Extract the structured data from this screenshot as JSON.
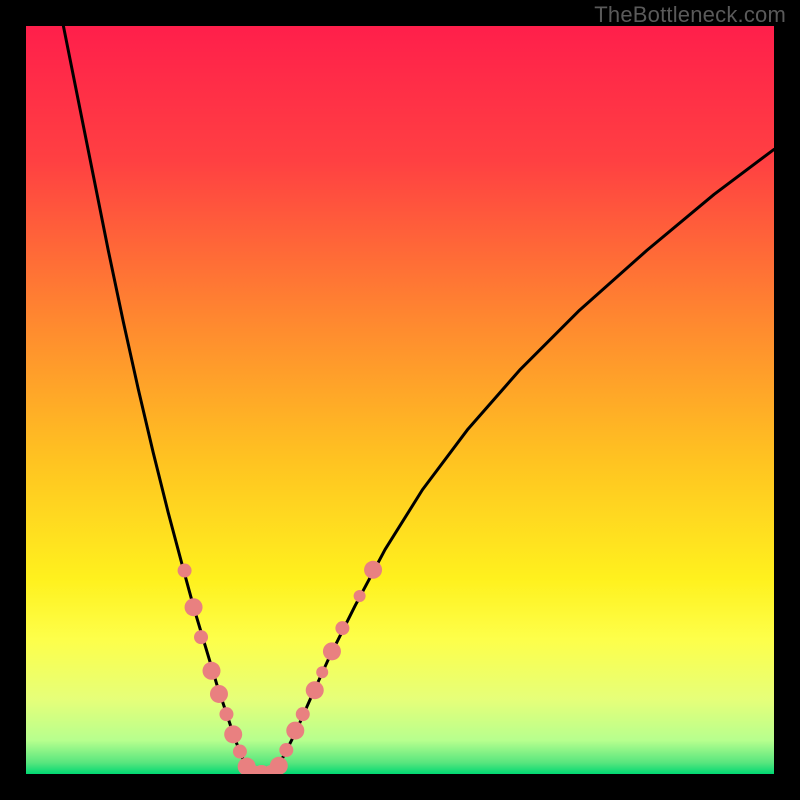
{
  "watermark": "TheBottleneck.com",
  "chart_data": {
    "type": "line",
    "title": "",
    "xlabel": "",
    "ylabel": "",
    "xlim": [
      0,
      100
    ],
    "ylim": [
      0,
      100
    ],
    "grid": false,
    "legend": null,
    "gradient_stops": [
      {
        "offset": 0.0,
        "color": "#ff1f4b"
      },
      {
        "offset": 0.18,
        "color": "#ff4042"
      },
      {
        "offset": 0.4,
        "color": "#ff8a2f"
      },
      {
        "offset": 0.58,
        "color": "#ffc321"
      },
      {
        "offset": 0.74,
        "color": "#fff11e"
      },
      {
        "offset": 0.82,
        "color": "#fdff4a"
      },
      {
        "offset": 0.9,
        "color": "#e6ff79"
      },
      {
        "offset": 0.955,
        "color": "#b7ff8e"
      },
      {
        "offset": 0.985,
        "color": "#58e67e"
      },
      {
        "offset": 1.0,
        "color": "#00d873"
      }
    ],
    "series": [
      {
        "name": "left-branch",
        "stroke": "#000000",
        "x": [
          5,
          7,
          9,
          11,
          13,
          15,
          17,
          19,
          21,
          22.5,
          24,
          25.5,
          27,
          28,
          29,
          30
        ],
        "y": [
          100,
          90,
          80,
          70,
          60.5,
          51.5,
          43,
          35,
          27.5,
          22,
          17,
          12,
          7.5,
          4.5,
          2,
          0
        ]
      },
      {
        "name": "right-branch",
        "stroke": "#000000",
        "x": [
          33,
          34.5,
          36,
          38,
          40.5,
          44,
          48,
          53,
          59,
          66,
          74,
          83,
          92,
          100
        ],
        "y": [
          0,
          2.5,
          5.5,
          10,
          15.5,
          22.5,
          30,
          38,
          46,
          54,
          62,
          70,
          77.5,
          83.5
        ]
      },
      {
        "name": "flat-bottom",
        "stroke": "#000000",
        "x": [
          30,
          31.5,
          33
        ],
        "y": [
          0,
          0,
          0
        ]
      }
    ],
    "markers": {
      "color": "#e98080",
      "left_branch_points": [
        {
          "x": 21.2,
          "y": 27.2,
          "r": 7
        },
        {
          "x": 22.4,
          "y": 22.3,
          "r": 9
        },
        {
          "x": 23.4,
          "y": 18.3,
          "r": 7
        },
        {
          "x": 24.8,
          "y": 13.8,
          "r": 9
        },
        {
          "x": 25.8,
          "y": 10.7,
          "r": 9
        },
        {
          "x": 26.8,
          "y": 8.0,
          "r": 7
        },
        {
          "x": 27.7,
          "y": 5.3,
          "r": 9
        },
        {
          "x": 28.6,
          "y": 3.0,
          "r": 7
        },
        {
          "x": 29.5,
          "y": 1.0,
          "r": 9
        }
      ],
      "right_branch_points": [
        {
          "x": 33.8,
          "y": 1.1,
          "r": 9
        },
        {
          "x": 34.8,
          "y": 3.2,
          "r": 7
        },
        {
          "x": 36.0,
          "y": 5.8,
          "r": 9
        },
        {
          "x": 37.0,
          "y": 8.0,
          "r": 7
        },
        {
          "x": 38.6,
          "y": 11.2,
          "r": 9
        },
        {
          "x": 39.6,
          "y": 13.6,
          "r": 6
        },
        {
          "x": 40.9,
          "y": 16.4,
          "r": 9
        },
        {
          "x": 42.3,
          "y": 19.5,
          "r": 7
        },
        {
          "x": 44.6,
          "y": 23.8,
          "r": 6
        },
        {
          "x": 46.4,
          "y": 27.3,
          "r": 9
        }
      ],
      "bottom_points": [
        {
          "x": 30.3,
          "y": 0.0,
          "r": 9
        },
        {
          "x": 31.5,
          "y": 0.0,
          "r": 9
        },
        {
          "x": 32.8,
          "y": 0.0,
          "r": 9
        }
      ]
    }
  }
}
